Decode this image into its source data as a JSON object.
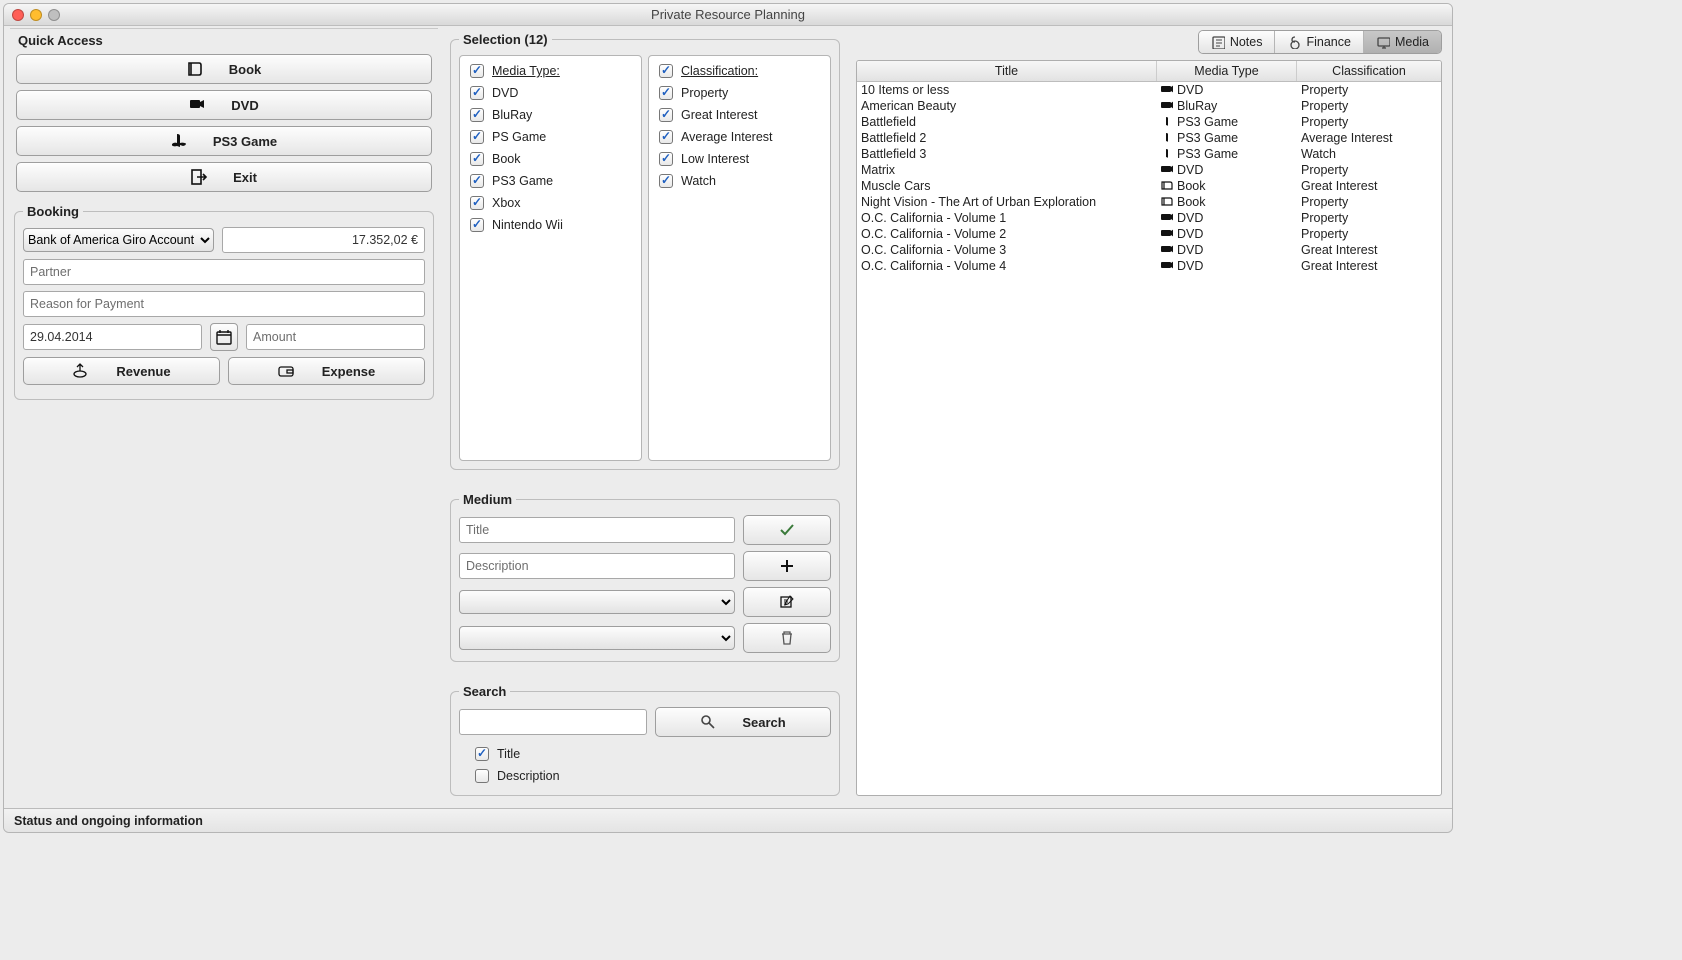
{
  "window": {
    "title": "Private Resource Planning"
  },
  "status": "Status and ongoing information",
  "quick_access": {
    "header": "Quick Access",
    "book": "Book",
    "dvd": "DVD",
    "ps3": "PS3 Game",
    "exit": "Exit"
  },
  "booking": {
    "header": "Booking",
    "account": "Bank of America Giro Account",
    "balance": "17.352,02 €",
    "partner_ph": "Partner",
    "reason_ph": "Reason for Payment",
    "date": "29.04.2014",
    "amount_ph": "Amount",
    "revenue": "Revenue",
    "expense": "Expense"
  },
  "tabs": {
    "notes": "Notes",
    "finance": "Finance",
    "media": "Media"
  },
  "selection": {
    "header": "Selection (12)",
    "media_type": "Media Type:",
    "classification": "Classification:",
    "types": [
      "DVD",
      "BluRay",
      "PS Game",
      "Book",
      "PS3 Game",
      "Xbox",
      "Nintendo Wii"
    ],
    "classes": [
      "Property",
      "Great Interest",
      "Average Interest",
      "Low Interest",
      "Watch"
    ]
  },
  "medium": {
    "header": "Medium",
    "title_ph": "Title",
    "desc_ph": "Description"
  },
  "search": {
    "header": "Search",
    "btn": "Search",
    "title_chk": "Title",
    "desc_chk": "Description"
  },
  "table": {
    "headers": {
      "title": "Title",
      "mt": "Media Type",
      "cl": "Classification"
    },
    "rows": [
      {
        "t": "10 Items or less",
        "mt": "DVD",
        "cl": "Property",
        "ico": "disc"
      },
      {
        "t": "American Beauty",
        "mt": "BluRay",
        "cl": "Property",
        "ico": "disc"
      },
      {
        "t": "Battlefield",
        "mt": "PS3 Game",
        "cl": "Property",
        "ico": "game"
      },
      {
        "t": "Battlefield 2",
        "mt": "PS3 Game",
        "cl": "Average Interest",
        "ico": "game"
      },
      {
        "t": "Battlefield 3",
        "mt": "PS3 Game",
        "cl": "Watch",
        "ico": "game"
      },
      {
        "t": "Matrix",
        "mt": "DVD",
        "cl": "Property",
        "ico": "disc"
      },
      {
        "t": "Muscle Cars",
        "mt": "Book",
        "cl": "Great Interest",
        "ico": "book"
      },
      {
        "t": "Night Vision - The Art of Urban Exploration",
        "mt": "Book",
        "cl": "Property",
        "ico": "book"
      },
      {
        "t": "O.C. California - Volume 1",
        "mt": "DVD",
        "cl": "Property",
        "ico": "disc"
      },
      {
        "t": "O.C. California - Volume 2",
        "mt": "DVD",
        "cl": "Property",
        "ico": "disc"
      },
      {
        "t": "O.C. California - Volume 3",
        "mt": "DVD",
        "cl": "Great Interest",
        "ico": "disc"
      },
      {
        "t": "O.C. California - Volume 4",
        "mt": "DVD",
        "cl": "Great Interest",
        "ico": "disc"
      }
    ]
  }
}
